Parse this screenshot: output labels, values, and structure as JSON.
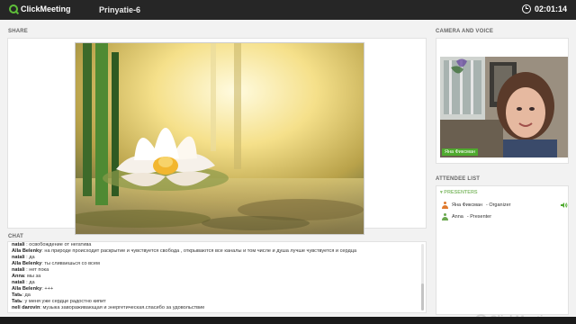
{
  "topbar": {
    "brand": "ClickMeeting",
    "room_name": "Prinyatie-6",
    "timer": "02:01:14"
  },
  "share": {
    "title": "SHARE"
  },
  "chat": {
    "title": "CHAT",
    "messages": [
      {
        "author": "natali",
        "text": " : освобождение от негатива"
      },
      {
        "author": "Alla Belenky",
        "text": ": на природе происходит раскрытие и чувствуется свобода , открываются все каналы и том числе и душа лучше чувствуется и сердца"
      },
      {
        "author": "natali",
        "text": " : да"
      },
      {
        "author": "Alla Belenky",
        "text": ": ты сливаешься  со всем"
      },
      {
        "author": "natali",
        "text": " : нет пока"
      },
      {
        "author": "Anna",
        "text": ": мы за"
      },
      {
        "author": "natali",
        "text": " : да"
      },
      {
        "author": "Alla Belenky",
        "text": ": +++"
      },
      {
        "author": "Tatь",
        "text": ": да"
      },
      {
        "author": "Tatь",
        "text": ": у меня уже сердце радостно кипит"
      },
      {
        "author": "neli darovin",
        "text": ": музыка завораживающая и энергетическая.спасибо за удовольствие"
      }
    ]
  },
  "camera": {
    "title": "CAMERA AND VOICE",
    "label": "Яна Фиксман"
  },
  "attendees": {
    "title": "ATTENDEE LIST",
    "group": "PRESENTERS",
    "list": [
      {
        "name": "Яна Фиксман",
        "role": " - Organizer",
        "icon": "organizer-user-icon"
      },
      {
        "name": "Anna",
        "role": " - Presenter",
        "icon": "presenter-user-icon"
      }
    ]
  },
  "watermark": {
    "brand": "ClickMeeting"
  },
  "colors": {
    "brand_green": "#5fbf3a",
    "topbar": "#262626",
    "panel_bg": "#f2f2f2"
  }
}
